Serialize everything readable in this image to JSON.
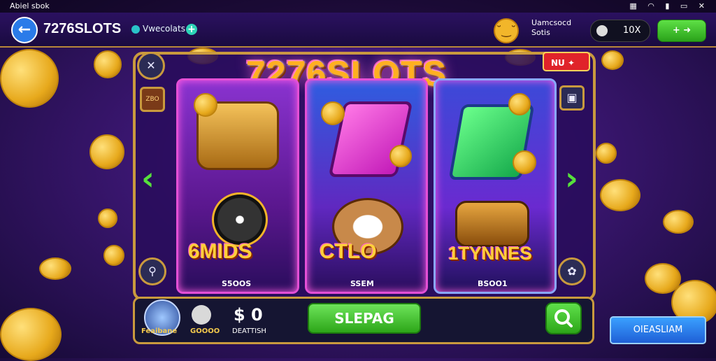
{
  "status_bar": {
    "left_text": "Abiel sbok",
    "right_icons": [
      "grid-icon",
      "wifi-icon",
      "signal-icon",
      "window-icon",
      "close-icon"
    ]
  },
  "topbar": {
    "brand": "7276SLOTS",
    "venue_label": "Vwecolats",
    "user_line1": "Uamcsocd",
    "user_line2": "Sotis",
    "pill_value": "10X",
    "green_label": "+"
  },
  "logo_text": "7276SLOTS",
  "new_badge": "NU",
  "side_labels": {
    "left_top": "ZBO"
  },
  "reels": [
    {
      "title": "6MIDS",
      "sub": "S5OOS"
    },
    {
      "title": "CTLO",
      "sub": "SSEM"
    },
    {
      "title": "1TYNNES",
      "sub": "BSOO1"
    }
  ],
  "bottom": {
    "badge_label": "Feaibane",
    "bag_label": "GOOOO",
    "amount": "$ 0",
    "amount_sub": "DEATTISH",
    "spin_label": "SLEPAG",
    "blue_button": "OIEASLIAM"
  }
}
